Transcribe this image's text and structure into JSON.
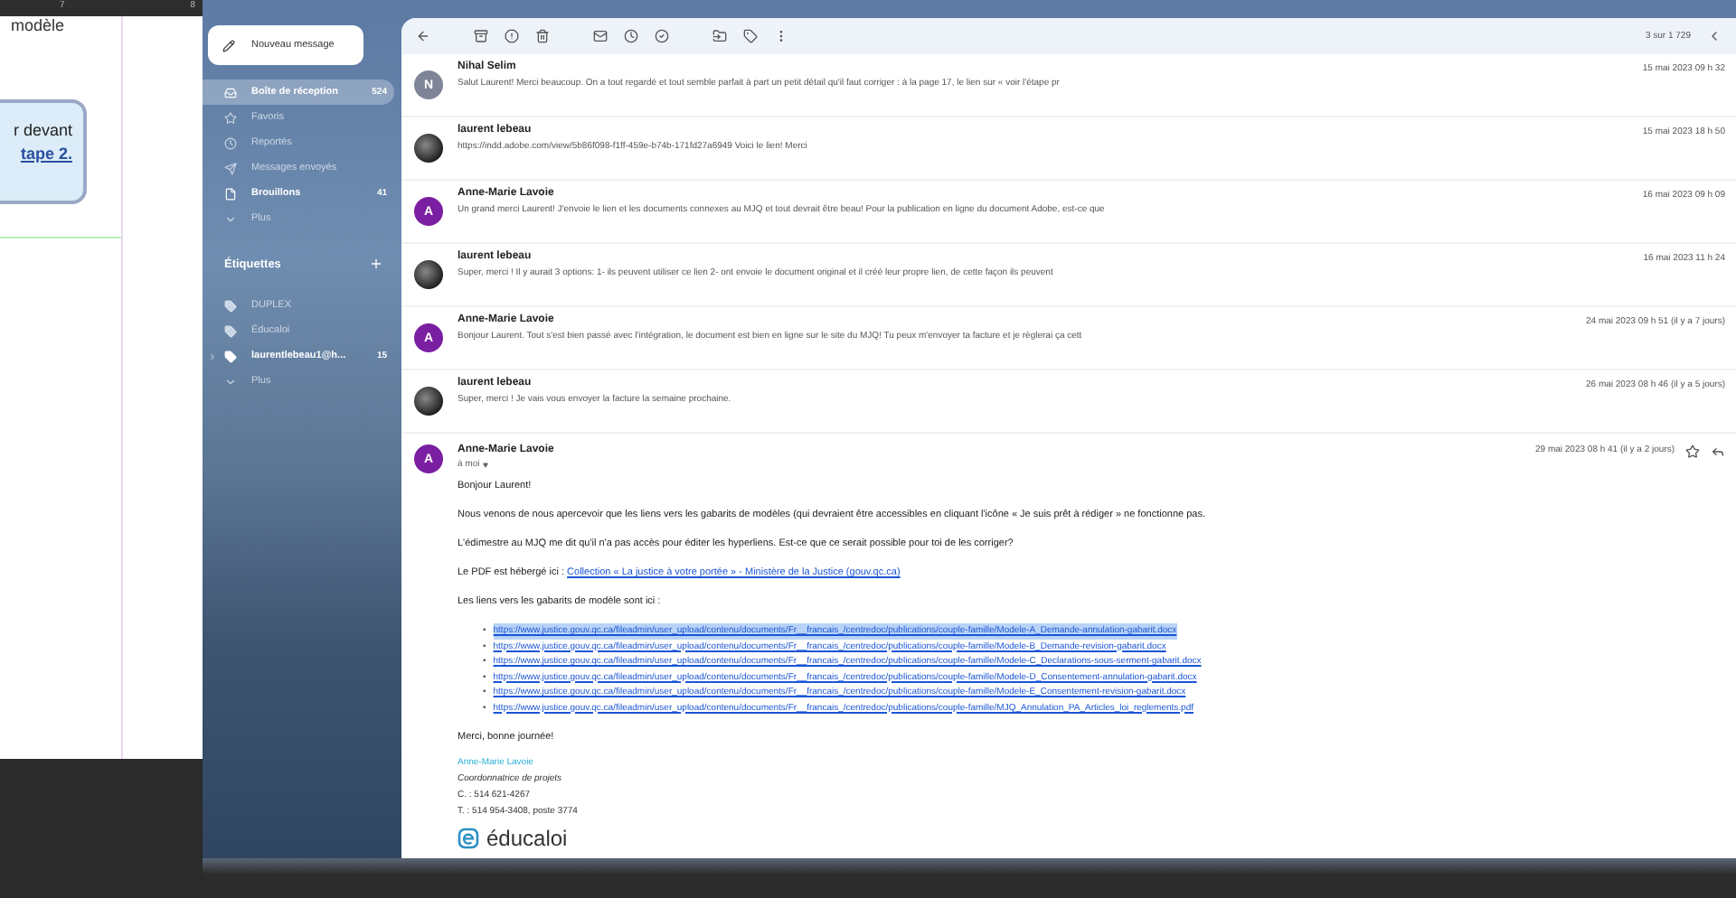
{
  "document": {
    "ruler_labels": [
      "7",
      "8"
    ],
    "heading_fragment": "modèle",
    "callout": {
      "text": "r devant",
      "link": "tape 2."
    }
  },
  "sidebar": {
    "compose": "Nouveau message",
    "items": [
      {
        "label": "Boîte de réception",
        "count": "524",
        "selected": true,
        "bold": true
      },
      {
        "label": "Favoris",
        "selected": false,
        "bold": false
      },
      {
        "label": "Reportés",
        "selected": false,
        "bold": false
      },
      {
        "label": "Messages envoyés",
        "selected": false,
        "bold": false
      },
      {
        "label": "Brouillons",
        "count": "41",
        "selected": false,
        "bold": true
      },
      {
        "label": "Plus",
        "selected": false,
        "bold": false
      }
    ],
    "labels_title": "Étiquettes",
    "labels": [
      {
        "kind": "label",
        "label": "DUPLEX",
        "bold": false
      },
      {
        "kind": "label",
        "label": "Éducaloi",
        "bold": false
      },
      {
        "kind": "label",
        "label": "laurentlebeau1@h...",
        "count": "15",
        "bold": true,
        "expandable": true
      },
      {
        "kind": "more",
        "label": "Plus",
        "bold": false
      }
    ]
  },
  "toolbar": {
    "pager": "3 sur 1 729"
  },
  "messages": [
    {
      "sender": "Nihal Selim",
      "avatar": {
        "kind": "letter",
        "letter": "N",
        "color": "#7d8596"
      },
      "snippet": "Salut Laurent! Merci beaucoup. On a tout regardé et tout semble parfait à part un petit détail qu'il faut corriger : à la page 17, le lien sur « voir l'étape pr",
      "date": "15 mai 2023 09 h 32"
    },
    {
      "sender": "laurent lebeau",
      "avatar": {
        "kind": "photo"
      },
      "snippet": "https://indd.adobe.com/view/5b86f098-f1ff-459e-b74b-171fd27a6949 Voici le lien! Merci",
      "date": "15 mai 2023 18 h 50"
    },
    {
      "sender": "Anne-Marie Lavoie",
      "avatar": {
        "kind": "letter",
        "letter": "A",
        "color": "#7b1fa2"
      },
      "snippet": "Un grand merci Laurent! J'envoie le lien et les documents connexes au MJQ et tout devrait être beau! Pour la publication en ligne du document Adobe, est-ce que",
      "date": "16 mai 2023 09 h 09"
    },
    {
      "sender": "laurent lebeau",
      "avatar": {
        "kind": "photo"
      },
      "snippet": "Super, merci ! Il y aurait 3 options: 1- ils peuvent utiliser ce lien 2- ont envoie le document original et il créé leur propre lien, de cette façon ils peuvent",
      "date": "16 mai 2023 11 h 24"
    },
    {
      "sender": "Anne-Marie Lavoie",
      "avatar": {
        "kind": "letter",
        "letter": "A",
        "color": "#7b1fa2"
      },
      "snippet": "Bonjour Laurent. Tout s'est bien passé avec l'intégration, le document est bien en ligne sur le site du MJQ! Tu peux m'envoyer ta facture et je règlerai ça cett",
      "date": "24 mai 2023 09 h 51 (il y a 7 jours)"
    },
    {
      "sender": "laurent lebeau",
      "avatar": {
        "kind": "photo"
      },
      "snippet": "Super, merci ! Je vais vous envoyer la facture la semaine prochaine.",
      "date": "26 mai 2023 08 h 46 (il y a 5 jours)"
    }
  ],
  "open_message": {
    "sender": "Anne-Marie Lavoie",
    "avatar": {
      "kind": "letter",
      "letter": "A",
      "color": "#7b1fa2"
    },
    "recipient": "à moi",
    "date": "29 mai 2023 08 h 41 (il y a 2 jours)",
    "body": [
      {
        "kind": "text",
        "text": "Bonjour Laurent!"
      },
      {
        "kind": "text",
        "text": "Nous venons de nous apercevoir que les liens vers les gabarits de modèles (qui devraient être accessibles en cliquant l'icône « Je suis prêt à rédiger » ne fonctionne pas."
      },
      {
        "kind": "text",
        "text": "L'édimestre au MJQ me dit qu'il n'a pas accès pour éditer les hyperliens. Est-ce que ce serait possible pour toi de les corriger?"
      },
      {
        "kind": "link_line",
        "text": "Le PDF est hébergé ici :",
        "link": "Collection « La justice à votre portée » - Ministère de la Justice (gouv.qc.ca)"
      },
      {
        "kind": "text",
        "text": "Les liens vers les gabarits de modèle sont ici :"
      },
      {
        "kind": "links",
        "items": [
          {
            "url": "https://www.justice.gouv.qc.ca/fileadmin/user_upload/contenu/documents/Fr__francais_/centredoc/publications/couple-famille/Modele-A_Demande-annulation-gabarit.docx",
            "selected": true,
            "bullet": "•"
          },
          {
            "url": "https://www.justice.gouv.qc.ca/fileadmin/user_upload/contenu/documents/Fr__francais_/centredoc/publications/couple-famille/Modele-B_Demande-revision-gabarit.docx",
            "selected": false,
            "bullet": "•"
          },
          {
            "url": "https://www.justice.gouv.qc.ca/fileadmin/user_upload/contenu/documents/Fr__francais_/centredoc/publications/couple-famille/Modele-C_Declarations-sous-serment-gabarit.docx",
            "selected": false,
            "bullet": "•"
          },
          {
            "url": "https://www.justice.gouv.qc.ca/fileadmin/user_upload/contenu/documents/Fr__francais_/centredoc/publications/couple-famille/Modele-D_Consentement-annulation-gabarit.docx",
            "selected": false,
            "bullet": "•"
          },
          {
            "url": "https://www.justice.gouv.qc.ca/fileadmin/user_upload/contenu/documents/Fr__francais_/centredoc/publications/couple-famille/Modele-E_Consentement-revision-gabarit.docx",
            "selected": false,
            "bullet": "•"
          },
          {
            "url": "https://www.justice.gouv.qc.ca/fileadmin/user_upload/contenu/documents/Fr__francais_/centredoc/publications/couple-famille/MJQ_Annulation_PA_Articles_loi_reglements.pdf",
            "selected": false,
            "bullet": "•"
          }
        ]
      },
      {
        "kind": "text",
        "text": "Merci, bonne journée!"
      }
    ],
    "signature": {
      "name": "Anne-Marie Lavoie",
      "title": "Coordonnatrice de projets",
      "lines": [
        "C. : 514 621-4267",
        "T. : 514 954-3408, poste 3774"
      ],
      "logo": "éducaloi"
    }
  }
}
